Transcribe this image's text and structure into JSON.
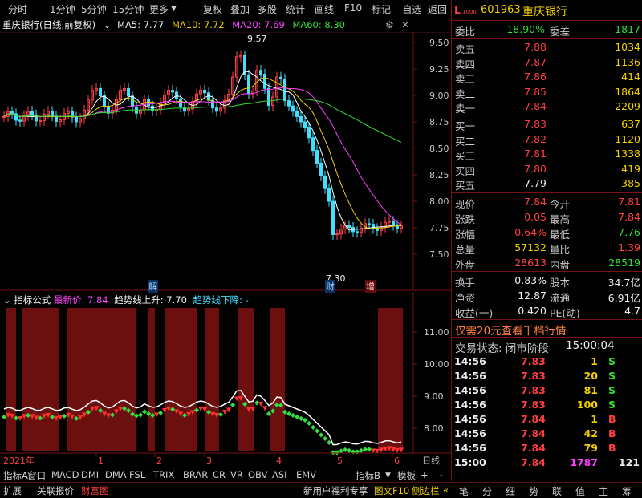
{
  "toolbar": {
    "left": [
      "分时",
      "1分钟",
      "5分钟",
      "15分钟",
      "更多"
    ],
    "right": [
      "复权",
      "叠加",
      "多股",
      "统计",
      "画线",
      "F10",
      "标记",
      "-自选",
      "返回"
    ]
  },
  "chart_title": {
    "stock": "重庆银行(日线,前复权)",
    "ma5": "MA5: 7.77",
    "ma10": "MA10: 7.72",
    "ma20": "MA20: 7.69",
    "ma60": "MA60: 8.30"
  },
  "price_axis": [
    "9.50",
    "9.25",
    "9.00",
    "8.75",
    "8.50",
    "8.25",
    "8.00",
    "7.75",
    "7.50"
  ],
  "annotations": {
    "high": "9.57",
    "low": "7.30",
    "marks": [
      "解",
      "财",
      "增"
    ]
  },
  "indicator_title": {
    "name": "指标公式",
    "latest_label": "最新价:",
    "latest_value": "7.84",
    "up_label": "趋势线上升:",
    "up_value": "7.70",
    "down_label": "趋势线下降:",
    "down_value": "-"
  },
  "indicator_axis": [
    "11.00",
    "10.00",
    "9.00",
    "8.00"
  ],
  "time_axis": {
    "year": "2021年",
    "months": [
      "1",
      "2",
      "3",
      "4",
      "5",
      "6"
    ],
    "period": "日线"
  },
  "tabs_row1": [
    "指标A",
    "窗口",
    "MACD",
    "DMI",
    "DMA",
    "FSL",
    "TRIX",
    "BRAR",
    "CR",
    "VR",
    "OBV",
    "ASI",
    "EMV"
  ],
  "tabs_row1_right": {
    "label": "指标B",
    "mode": "模板",
    "plus": "+",
    "minus": "-"
  },
  "tabs_row2": [
    "扩展",
    "关联报价",
    "财富图"
  ],
  "tabs_row2_right": [
    "新用户福利专享",
    "图文F10",
    "侧边栏"
  ],
  "right_buttons": [
    "笔",
    "分",
    "细",
    "势",
    "联",
    "值",
    "主",
    "筹"
  ],
  "quote": {
    "code": "601963",
    "name": "重庆银行",
    "tag": "L",
    "tag_sub": "1000",
    "weibi_label": "委比",
    "weibi": "-18.90%",
    "weicha_label": "委差",
    "weicha": "-1817",
    "asks": [
      {
        "label": "卖五",
        "price": "7.88",
        "vol": "1034"
      },
      {
        "label": "卖四",
        "price": "7.87",
        "vol": "1136"
      },
      {
        "label": "卖三",
        "price": "7.86",
        "vol": "414"
      },
      {
        "label": "卖二",
        "price": "7.85",
        "vol": "1864"
      },
      {
        "label": "卖一",
        "price": "7.84",
        "vol": "2209"
      }
    ],
    "bids": [
      {
        "label": "买一",
        "price": "7.83",
        "vol": "637"
      },
      {
        "label": "买二",
        "price": "7.82",
        "vol": "1120"
      },
      {
        "label": "买三",
        "price": "7.81",
        "vol": "1338"
      },
      {
        "label": "买四",
        "price": "7.80",
        "vol": "419"
      },
      {
        "label": "买五",
        "price": "7.79",
        "vol": "385"
      }
    ],
    "stats": [
      {
        "l1": "现价",
        "v1": "7.84",
        "l2": "今开",
        "v2": "7.81"
      },
      {
        "l1": "涨跌",
        "v1": "0.05",
        "l2": "最高",
        "v2": "7.84"
      },
      {
        "l1": "涨幅",
        "v1": "0.64%",
        "l2": "最低",
        "v2": "7.76"
      },
      {
        "l1": "总量",
        "v1": "57132",
        "l2": "量比",
        "v2": "1.39"
      },
      {
        "l1": "外盘",
        "v1": "28613",
        "l2": "内盘",
        "v2": "28519"
      }
    ],
    "stats2": [
      {
        "l1": "换手",
        "v1": "0.83%",
        "l2": "股本",
        "v2": "34.7亿"
      },
      {
        "l1": "净资",
        "v1": "12.87",
        "l2": "流通",
        "v2": "6.91亿"
      },
      {
        "l1": "收益(一)",
        "v1": "0.420",
        "l2": "PE(动)",
        "v2": "4.7"
      }
    ],
    "promo": "仅需20元查看千档行情",
    "status_label": "交易状态: 闭市阶段",
    "status_time": "15:00:04",
    "ticks": [
      {
        "t": "14:56",
        "p": "7.83",
        "v": "1",
        "s": "S"
      },
      {
        "t": "14:56",
        "p": "7.83",
        "v": "20",
        "s": "S"
      },
      {
        "t": "14:56",
        "p": "7.83",
        "v": "81",
        "s": "S"
      },
      {
        "t": "14:56",
        "p": "7.83",
        "v": "100",
        "s": "S"
      },
      {
        "t": "14:56",
        "p": "7.84",
        "v": "1",
        "s": "B"
      },
      {
        "t": "14:56",
        "p": "7.84",
        "v": "42",
        "s": "B"
      },
      {
        "t": "14:56",
        "p": "7.84",
        "v": "79",
        "s": "B"
      },
      {
        "t": "15:00",
        "p": "7.84",
        "v": "1787",
        "s": "",
        "n": "121"
      }
    ]
  },
  "colors": {
    "up": "#ff4040",
    "down": "#33dd33",
    "ma5": "#ffffff",
    "ma10": "#f0d000",
    "ma20": "#ff40ff",
    "ma60": "#33dd33",
    "grid": "#5a1010",
    "band": "#6b0f0f"
  }
}
